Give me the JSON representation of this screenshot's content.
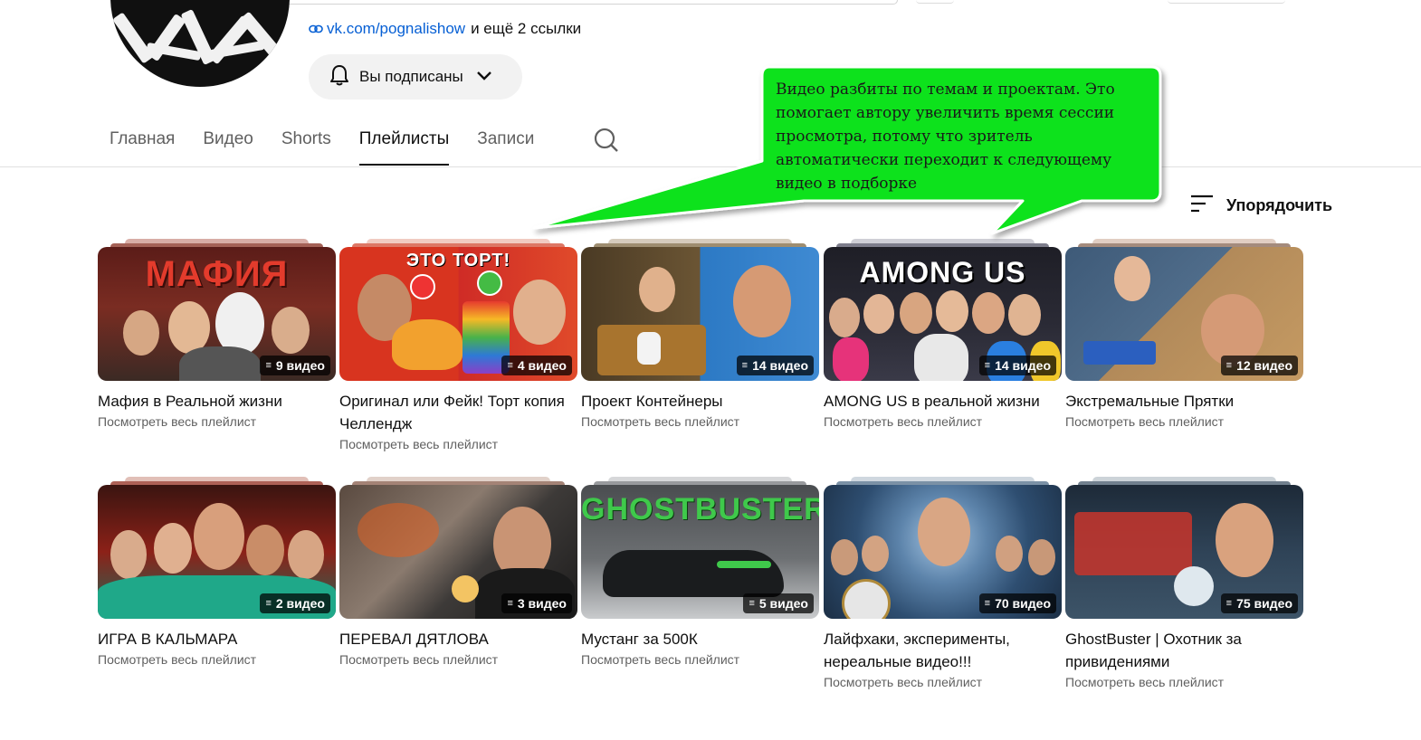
{
  "channel": {
    "link": "vk.com/pognalishow",
    "more_links": "и ещё 2 ссылки",
    "subscribe_label": "Вы подписаны"
  },
  "tabs": [
    {
      "label": "Главная"
    },
    {
      "label": "Видео"
    },
    {
      "label": "Shorts"
    },
    {
      "label": "Плейлисты"
    },
    {
      "label": "Записи"
    }
  ],
  "sort_label": "Упорядочить",
  "callout_text": "Видео разбиты по темам и проектам. Это помогает автору увеличить время сессии просмотра, потому что зритель автоматически переходит к следующему видео в подборке",
  "view_all": "Посмотреть весь плейлист",
  "playlists": [
    {
      "title": "Мафия в Реальной жизни",
      "count": "9 видео",
      "thumb_text": "МАФИЯ",
      "bg": "#7a2c22",
      "accent": "#e33b2c"
    },
    {
      "title": "Оригинал или Фейк! Торт копия Челлендж",
      "count": "4 видео",
      "thumb_text": "ЭТО ТОРТ!",
      "bg": "#d8341f",
      "accent": "#f6b926"
    },
    {
      "title": "Проект Контейнеры",
      "count": "14 видео",
      "thumb_text": "",
      "bg": "#5c4a2c",
      "accent": "#2c79c4"
    },
    {
      "title": "AMONG US в реальной жизни",
      "count": "14 видео",
      "thumb_text": "AMONG US",
      "bg": "#2b2b36",
      "accent": "#2fb7e2"
    },
    {
      "title": "Экстремальные Прятки",
      "count": "12 видео",
      "thumb_text": "",
      "bg": "#4f6c8a",
      "accent": "#c59a62"
    },
    {
      "title": "ИГРА В КАЛЬМАРА",
      "count": "2 видео",
      "thumb_text": "",
      "bg": "#8c2118",
      "accent": "#1fa889"
    },
    {
      "title": "ПЕРЕВАЛ ДЯТЛОВА",
      "count": "3 видео",
      "thumb_text": "",
      "bg": "#3d3a38",
      "accent": "#e26020"
    },
    {
      "title": "Мустанг за 500К",
      "count": "5 видео",
      "thumb_text": "GHOSTBUSTER",
      "bg": "#6d7073",
      "accent": "#3fc94b"
    },
    {
      "title": "Лайфхаки, эксперименты, нереальные видео!!!",
      "count": "70 видео",
      "thumb_text": "",
      "bg": "#2e4e71",
      "accent": "#a7c7e4"
    },
    {
      "title": "GhostBuster | Охотник за привидениями",
      "count": "75 видео",
      "thumb_text": "",
      "bg": "#2f4357",
      "accent": "#d0332c"
    }
  ]
}
